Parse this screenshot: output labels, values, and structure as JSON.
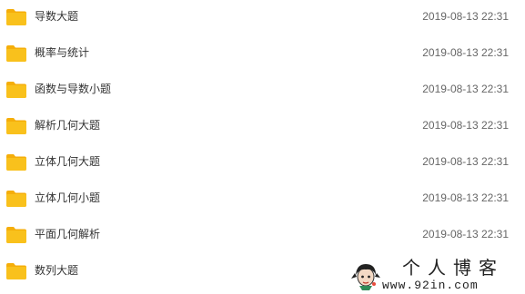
{
  "files": [
    {
      "name": "导数大题",
      "date": "2019-08-13 22:31",
      "icon": "folder-icon"
    },
    {
      "name": "概率与统计",
      "date": "2019-08-13 22:31",
      "icon": "folder-icon"
    },
    {
      "name": "函数与导数小题",
      "date": "2019-08-13 22:31",
      "icon": "folder-icon"
    },
    {
      "name": "解析几何大题",
      "date": "2019-08-13 22:31",
      "icon": "folder-icon"
    },
    {
      "name": "立体几何大题",
      "date": "2019-08-13 22:31",
      "icon": "folder-icon"
    },
    {
      "name": "立体几何小题",
      "date": "2019-08-13 22:31",
      "icon": "folder-icon"
    },
    {
      "name": "平面几何解析",
      "date": "2019-08-13 22:31",
      "icon": "folder-icon"
    },
    {
      "name": "数列大题",
      "date": "",
      "icon": "folder-icon"
    }
  ],
  "watermark": {
    "title": "个人博客",
    "url": "www.92in.com"
  },
  "colors": {
    "folder": "#F9C11C",
    "folder_tab": "#F5AE0A",
    "text": "#333333",
    "date": "#666666"
  }
}
